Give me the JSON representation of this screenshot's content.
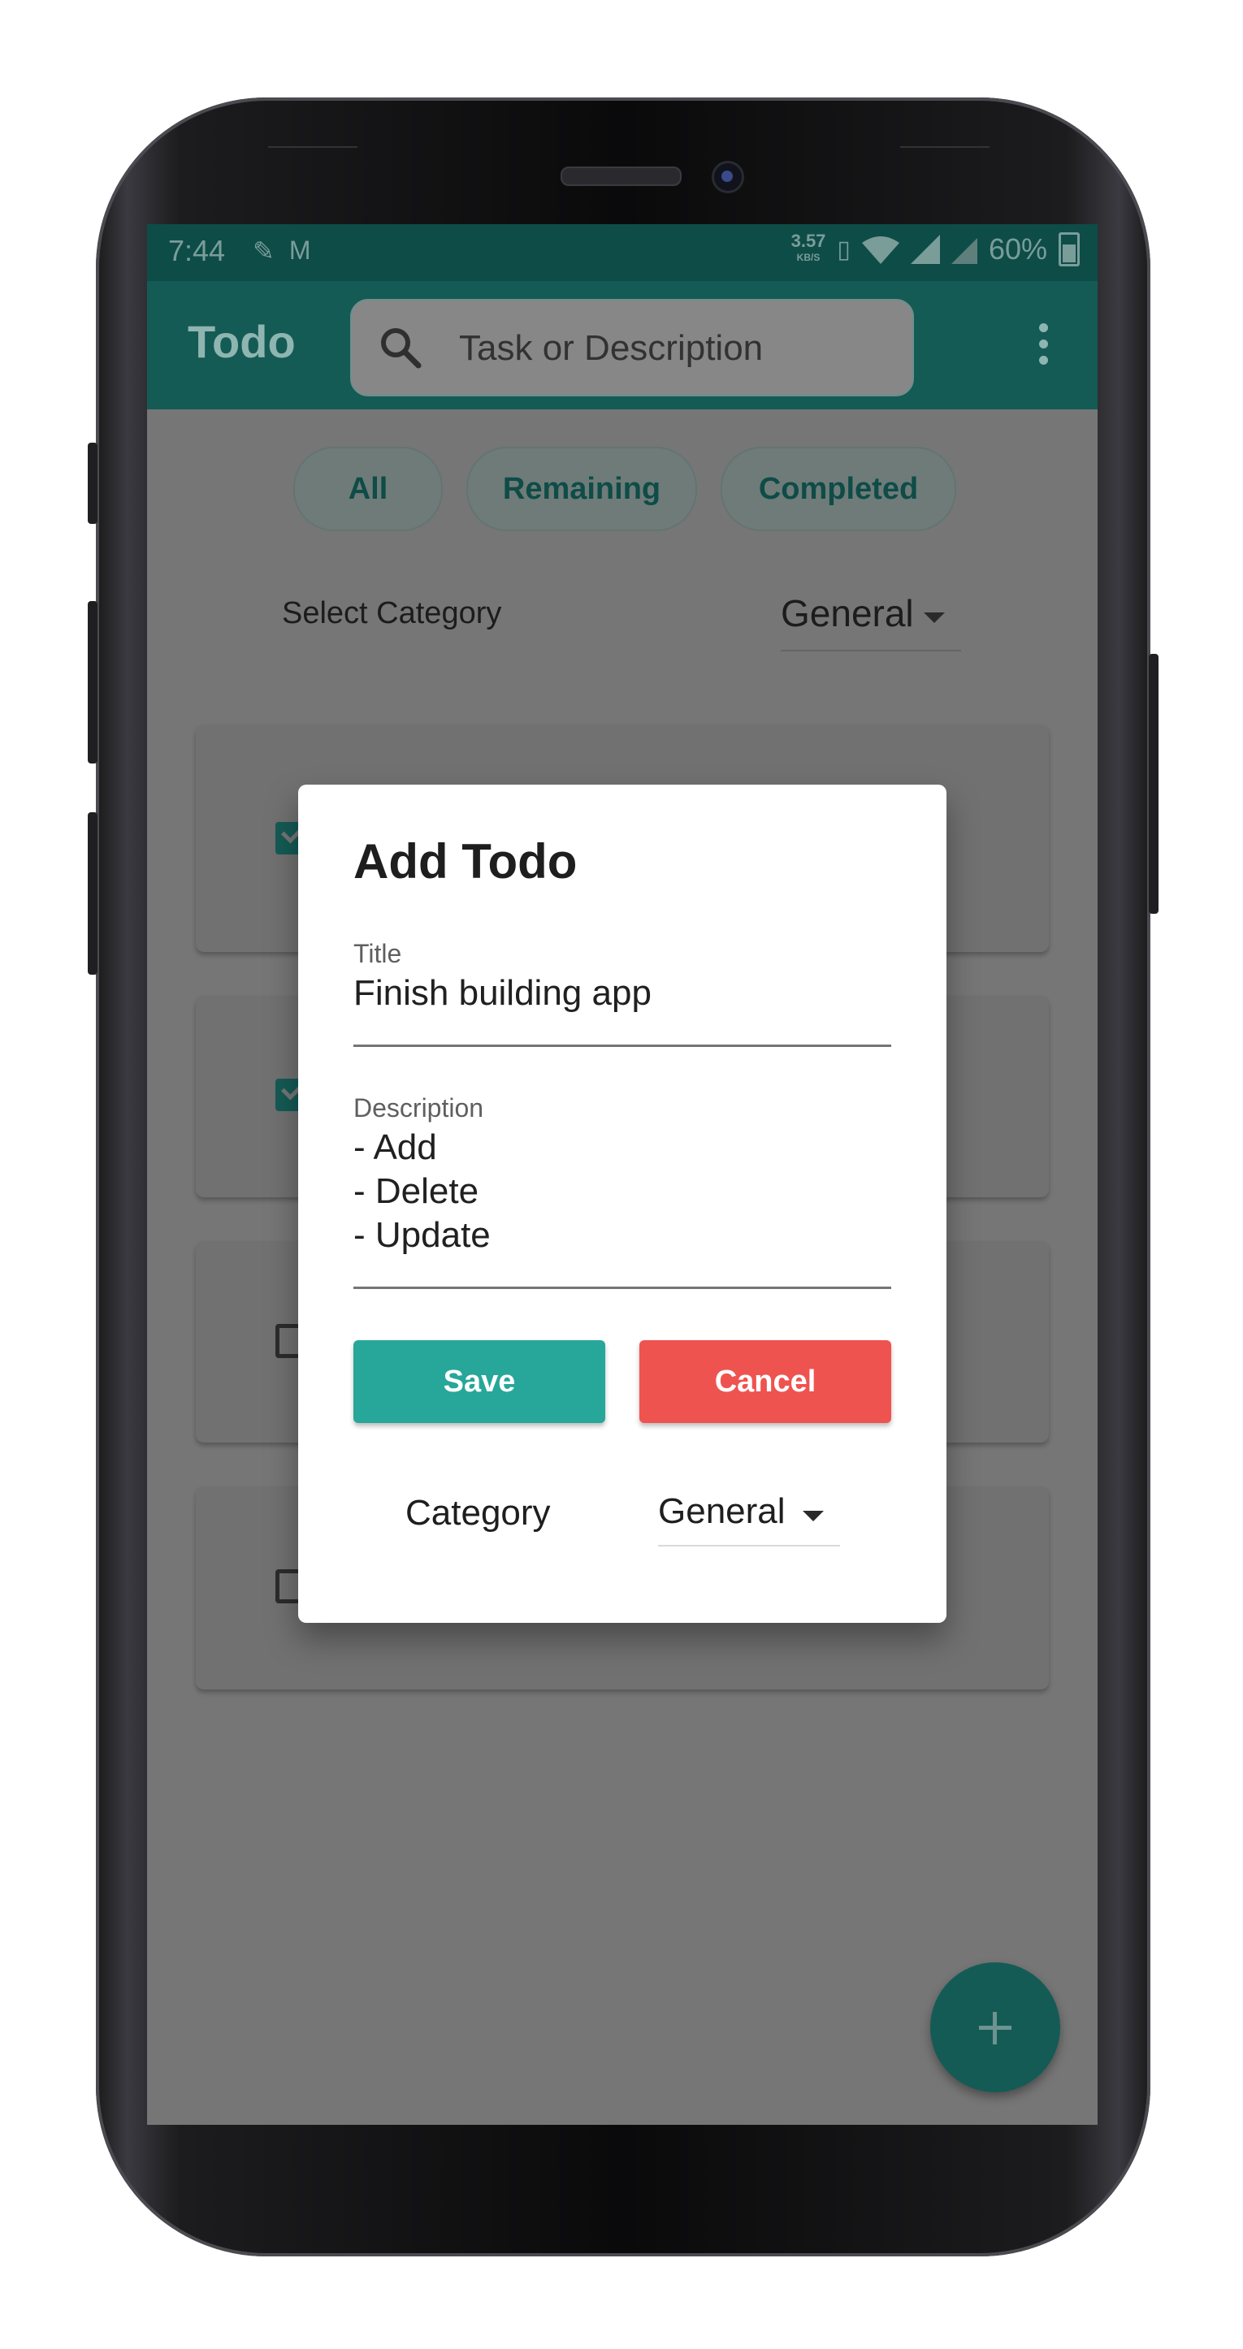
{
  "status_bar": {
    "time": "7:44",
    "left_icons": [
      "notification-icon",
      "gmail-icon"
    ],
    "net_speed": "3.57",
    "net_speed_unit": "KB/S",
    "battery": "60%"
  },
  "app_bar": {
    "title": "Todo",
    "search_placeholder": "Task or Description"
  },
  "filters": {
    "all": "All",
    "remaining": "Remaining",
    "completed": "Completed"
  },
  "category_selector": {
    "label": "Select Category",
    "value": "General"
  },
  "todo_cards": [
    {
      "checked": true
    },
    {
      "checked": true
    },
    {
      "checked": false
    },
    {
      "checked": false
    }
  ],
  "dialog": {
    "title": "Add Todo",
    "title_field_label": "Title",
    "title_field_value": "Finish building app",
    "description_label": "Description",
    "description_lines": [
      "- Add",
      "- Delete",
      "- Update"
    ],
    "save_label": "Save",
    "cancel_label": "Cancel",
    "category_label": "Category",
    "category_value": "General"
  },
  "colors": {
    "primary": "#155b55",
    "save": "#27a69a",
    "cancel": "#ef5350",
    "overlay": "#767676"
  }
}
